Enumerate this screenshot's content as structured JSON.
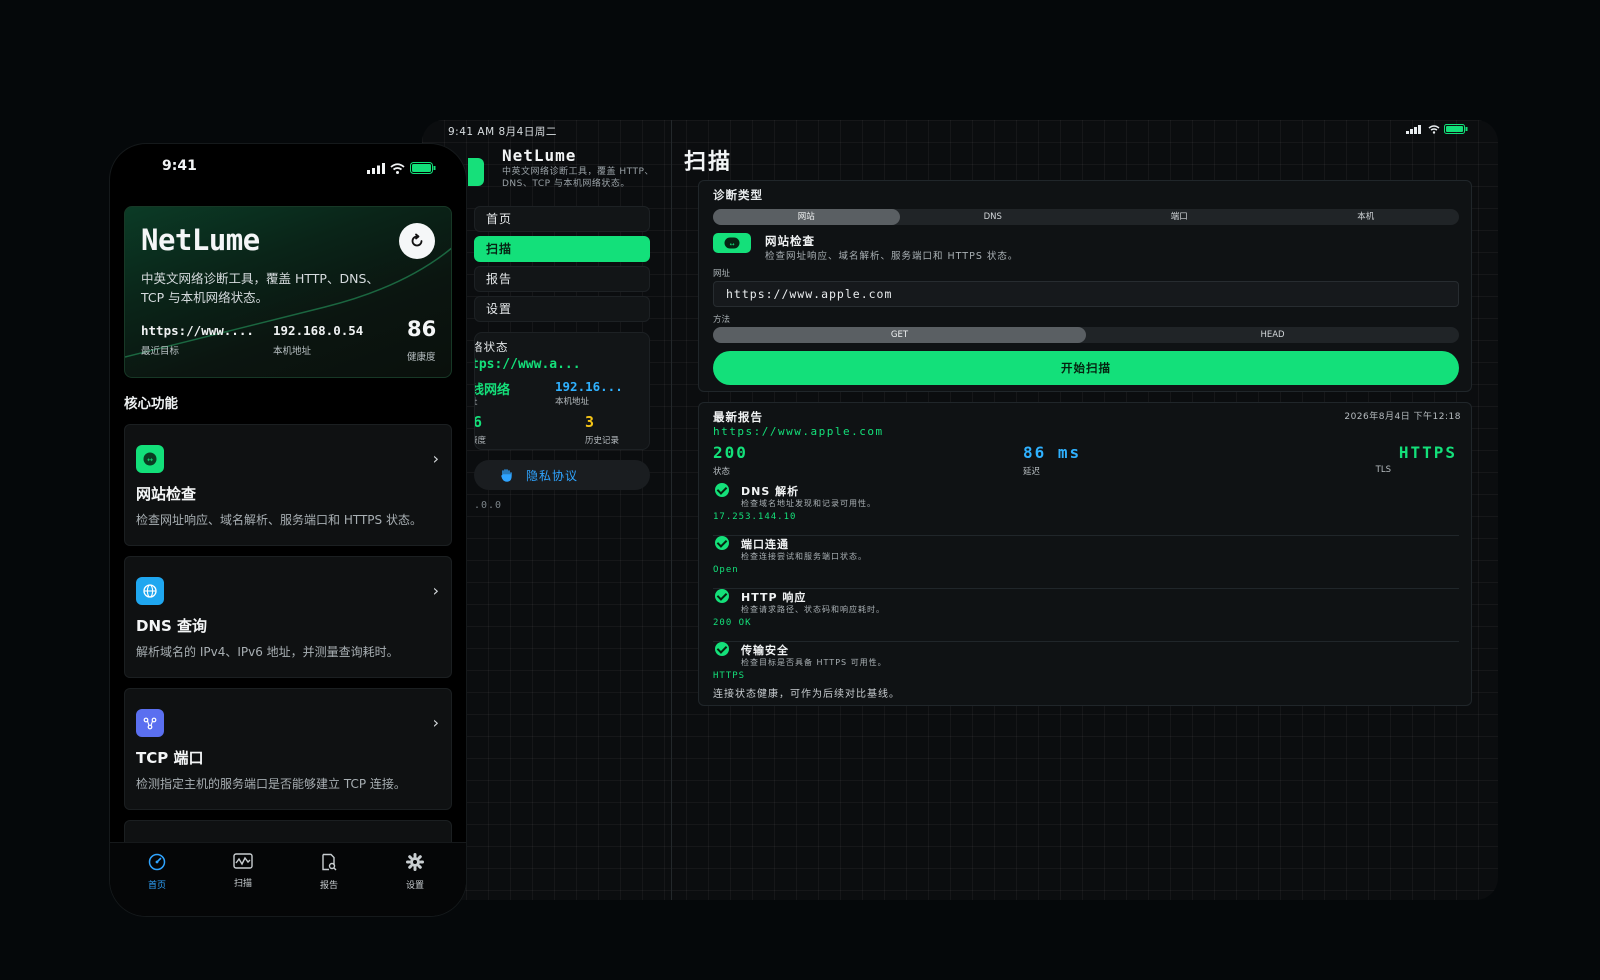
{
  "colors": {
    "accent_green": "#13e07a",
    "accent_blue": "#2fa4ff",
    "yellow": "#f5c416",
    "bg": "#05080a"
  },
  "ipad": {
    "status_time": "9:41 AM  8月4日周二",
    "sidebar": {
      "brand": "NetLume",
      "brand_desc": "中英文网络诊断工具，覆盖 HTTP、DNS、TCP 与本机网络状态。",
      "nav": [
        {
          "label": "首页",
          "icon": "home-icon"
        },
        {
          "label": "扫描",
          "icon": "scan-icon",
          "active": true
        },
        {
          "label": "报告",
          "icon": "report-icon"
        },
        {
          "label": "设置",
          "icon": "gear-icon"
        }
      ],
      "status_card": {
        "title": "络状态",
        "url": "tps://www.a...",
        "net": "线网络",
        "ip": "192.16...",
        "ip_label": "本机地址",
        "sub_label": "址",
        "num1": "6",
        "num1_label": "康度",
        "num2": "3",
        "num2_label": "历史记录"
      },
      "privacy": "隐私协议",
      "version": ".0.0"
    },
    "main": {
      "title": "扫描",
      "scan": {
        "type_label": "诊断类型",
        "types": [
          "网站",
          "DNS",
          "端口",
          "本机"
        ],
        "selected_type": "网站",
        "type_title": "网站检查",
        "type_desc": "检查网址响应、域名解析、服务端口和 HTTPS 状态。",
        "url_label": "网址",
        "url_value": "https://www.apple.com",
        "method_label": "方法",
        "methods": [
          "GET",
          "HEAD"
        ],
        "selected_method": "GET",
        "start_button": "开始扫描"
      },
      "report": {
        "title": "最新报告",
        "date": "2026年8月4日 下午12:18",
        "url": "https://www.apple.com",
        "status_value": "200",
        "status_label": "状态",
        "latency_value": "86 ms",
        "latency_label": "延迟",
        "tls_value": "HTTPS",
        "tls_label": "TLS",
        "checks": [
          {
            "title": "DNS 解析",
            "desc": "检查域名地址发现和记录可用性。",
            "value": "17.253.144.10"
          },
          {
            "title": "端口连通",
            "desc": "检查连接尝试和服务端口状态。",
            "value": "Open"
          },
          {
            "title": "HTTP 响应",
            "desc": "检查请求路径、状态码和响应耗时。",
            "value": "200 OK"
          },
          {
            "title": "传输安全",
            "desc": "检查目标是否具备 HTTPS 可用性。",
            "value": "HTTPS"
          }
        ],
        "footer": "连接状态健康，可作为后续对比基线。"
      }
    }
  },
  "phone": {
    "time": "9:41",
    "hero": {
      "title": "NetLume",
      "desc": "中英文网络诊断工具，覆盖 HTTP、DNS、TCP 与本机网络状态。",
      "recent_value": "https://www....",
      "recent_label": "最近目标",
      "ip_value": "192.168.0.54",
      "ip_label": "本机地址",
      "health_value": "86",
      "health_label": "健康度"
    },
    "section_title": "核心功能",
    "features": [
      {
        "title": "网站检查",
        "desc": "检查网址响应、域名解析、服务端口和 HTTPS 状态。",
        "icon": "http-icon",
        "color": "#13e07a"
      },
      {
        "title": "DNS 查询",
        "desc": "解析域名的 IPv4、IPv6 地址，并测量查询耗时。",
        "icon": "globe-icon",
        "color": "#1fa7f0"
      },
      {
        "title": "TCP 端口",
        "desc": "检测指定主机的服务端口是否能够建立 TCP 连接。",
        "icon": "network-nodes-icon",
        "color": "#5a6ff0"
      }
    ],
    "tabs": [
      {
        "label": "首页",
        "icon": "speedometer-icon",
        "active": true
      },
      {
        "label": "扫描",
        "icon": "pulse-chart-icon"
      },
      {
        "label": "报告",
        "icon": "document-search-icon"
      },
      {
        "label": "设置",
        "icon": "gear-icon"
      }
    ]
  }
}
